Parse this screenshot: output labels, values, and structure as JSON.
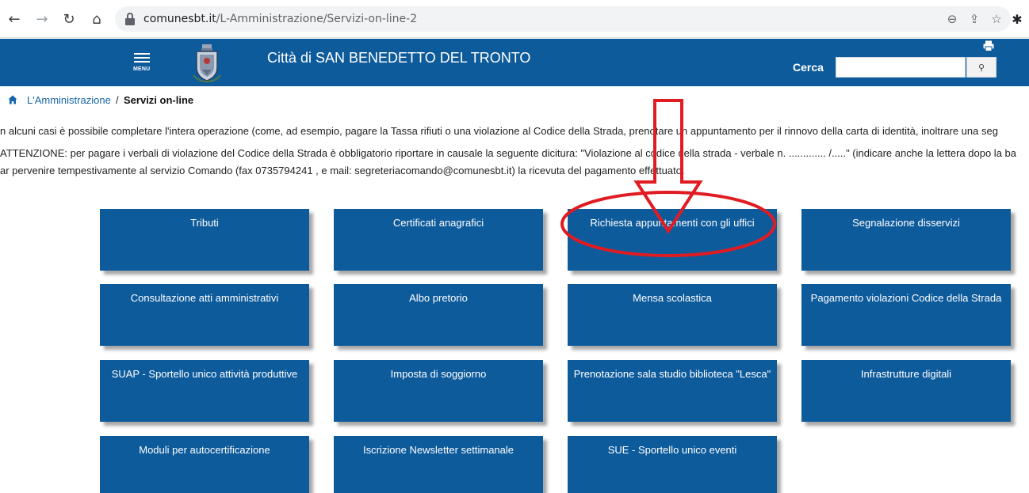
{
  "browser": {
    "url_host": "comunesbt.it",
    "url_path": "/L-Amministrazione/Servizi-on-line-2",
    "icons": [
      "back-arrow-icon",
      "forward-arrow-icon",
      "reload-icon",
      "home-icon",
      "lock-icon",
      "zoom-icon",
      "share-icon",
      "star-icon",
      "extensions-puzzle-icon"
    ]
  },
  "header": {
    "menu_label": "MENU",
    "site_title": "Città di SAN BENEDETTO DEL TRONTO",
    "search_label": "Cerca",
    "search_value": "",
    "bg_color": "#0e5b9c"
  },
  "breadcrumb": {
    "parent": "L'Amministrazione",
    "separator": "/",
    "current": "Servizi on-line"
  },
  "intro": {
    "line1": "n alcuni casi è possibile completare l'intera operazione (come, ad esempio, pagare la Tassa rifiuti o una violazione al Codice della Strada, prenotare un appuntamento per il rinnovo della carta di identità, inoltrare una seg",
    "line2": "ATTENZIONE: per pagare i verbali di violazione del Codice della Strada è obbligatorio riportare in causale la seguente dicitura: \"Violazione al codice della strada - verbale n. ............. /.....\" (indicare anche la lettera dopo la ba",
    "line3": "ar pervenire tempestivamente al servizio Comando (fax 0735794241 , e mail: segreteriacomando@comunesbt.it) la ricevuta del pagamento effettuato."
  },
  "tiles": [
    "Tributi",
    "Certificati anagrafici",
    "Richiesta appuntamenti con gli uffici",
    "Segnalazione disservizi",
    "Consultazione atti amministrativi",
    "Albo pretorio",
    "Mensa scolastica",
    "Pagamento violazioni Codice della Strada",
    "SUAP - Sportello unico attività produttive",
    "Imposta di soggiorno",
    "Prenotazione sala studio biblioteca \"Lesca\"",
    "Infrastrutture digitali",
    "Moduli per autocertificazione",
    "Iscrizione Newsletter settimanale",
    "SUE - Sportello unico eventi"
  ],
  "annotation": {
    "highlight_color": "#e11b22",
    "target": "Richiesta appuntamenti con gli uffici"
  }
}
